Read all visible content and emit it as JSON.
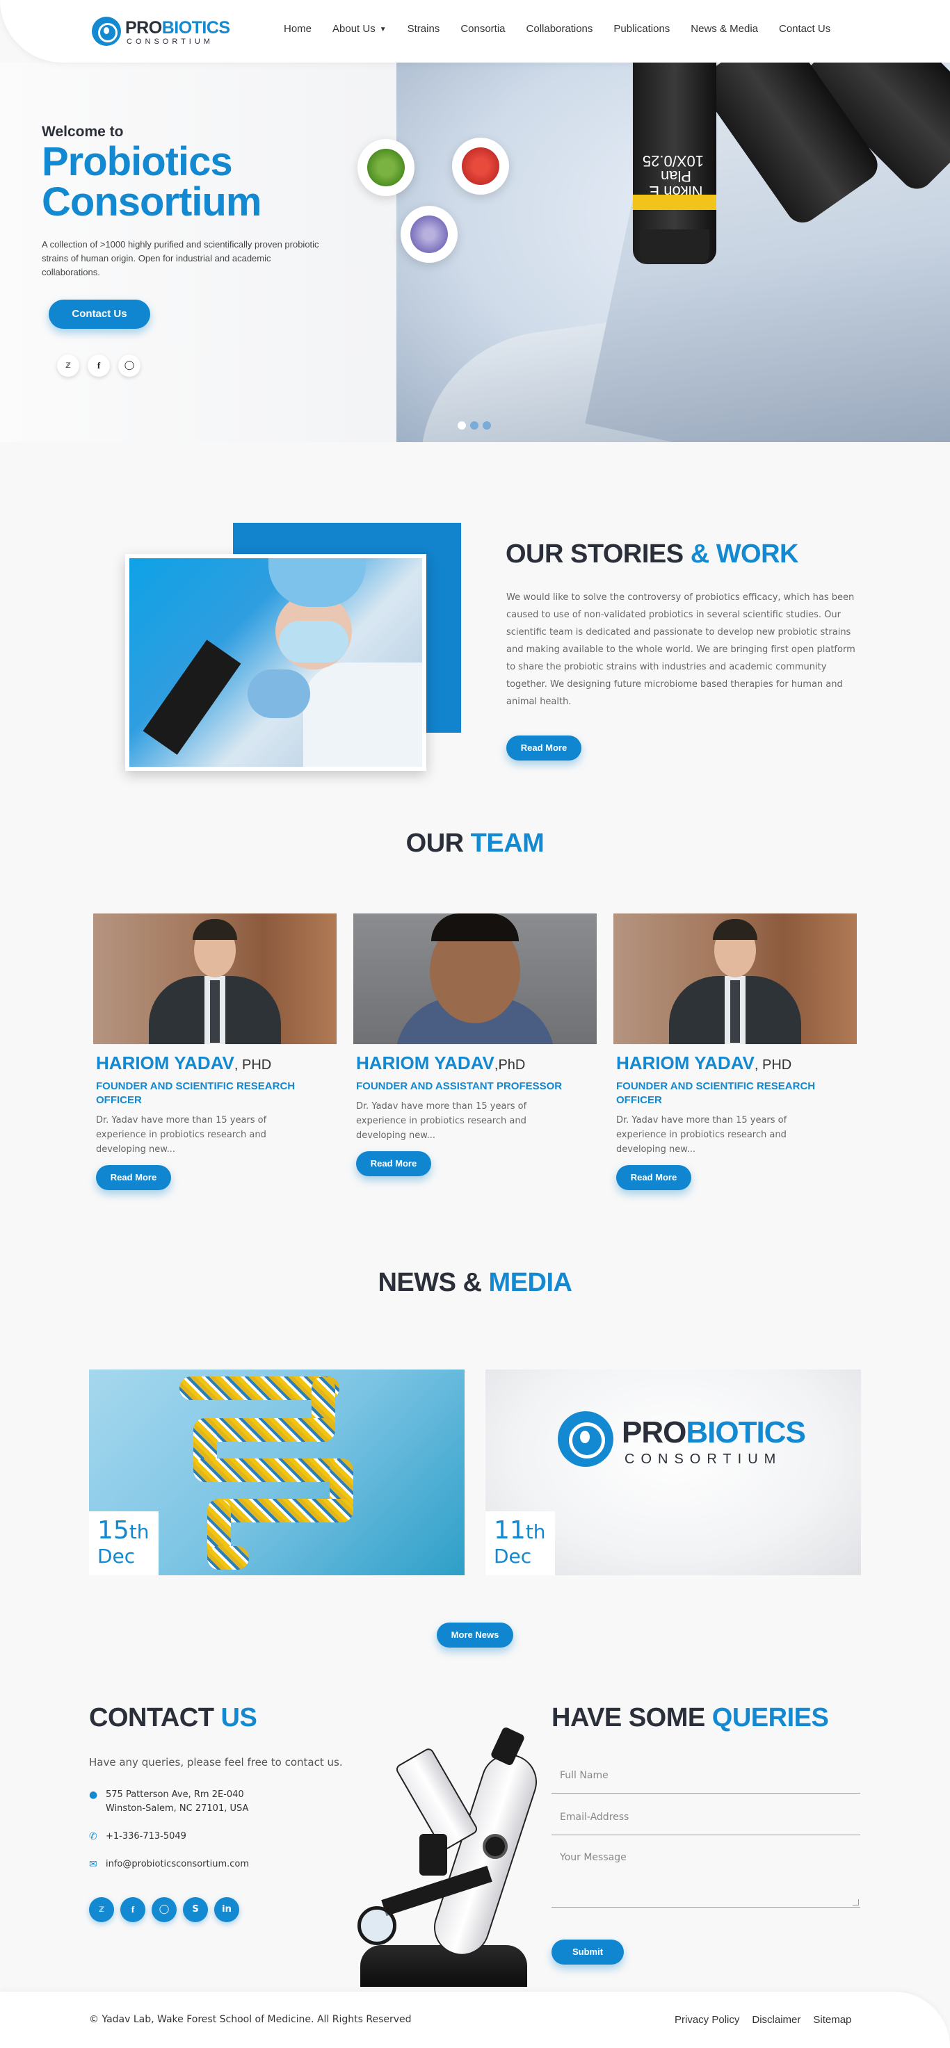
{
  "brand": {
    "part1": "PRO",
    "part2": "BIOTICS",
    "sub": "CONSORTIUM"
  },
  "nav": {
    "items": [
      {
        "label": "Home"
      },
      {
        "label": "About Us",
        "dropdown": true
      },
      {
        "label": "Strains"
      },
      {
        "label": "Consortia"
      },
      {
        "label": "Collaborations"
      },
      {
        "label": "Publications"
      },
      {
        "label": "News & Media"
      },
      {
        "label": "Contact Us"
      }
    ]
  },
  "hero": {
    "welcome": "Welcome to",
    "title": "Probiotics Consortium",
    "description": "A collection of >1000 highly purified and scientifically proven probiotic strains of human origin. Open for industrial and academic collaborations.",
    "cta": "Contact Us",
    "socials": [
      "twitter-icon",
      "facebook-icon",
      "instagram-icon"
    ],
    "objective_label": "Nikon E Plan 10X/0.25",
    "slider": {
      "total": 3,
      "active": 1
    }
  },
  "stories": {
    "title_dark": "OUR STORIES",
    "title_blue": "& WORK",
    "text": "We would like to solve the controversy of probiotics efficacy, which has been caused to use of non-validated probiotics in several scientific studies. Our scientific team is dedicated and passionate to develop new probiotic strains and making available to the whole world. We are bringing first open platform to share the probiotic strains with industries and academic community together. We designing future microbiome based therapies for human and animal health.",
    "button": "Read More"
  },
  "team": {
    "title_dark": "OUR",
    "title_blue": "TEAM",
    "members": [
      {
        "name": "HARIOM YADAV",
        "degree": ", PHD",
        "role": "FOUNDER AND SCIENTIFIC RESEARCH OFFICER",
        "bio": "Dr. Yadav have more than 15 years of experience in probiotics research and developing new...",
        "button": "Read More"
      },
      {
        "name": "HARIOM YADAV",
        "degree": ",PhD",
        "role": "FOUNDER AND ASSISTANT PROFESSOR",
        "bio": "Dr. Yadav have more than 15 years of experience in probiotics research and developing new...",
        "button": "Read More"
      },
      {
        "name": "HARIOM YADAV",
        "degree": ", PHD",
        "role": "FOUNDER AND SCIENTIFIC RESEARCH OFFICER",
        "bio": "Dr. Yadav have more than 15 years of experience in probiotics research and developing new...",
        "button": "Read More"
      }
    ]
  },
  "news": {
    "title_dark": "NEWS &",
    "title_blue": "MEDIA",
    "items": [
      {
        "day": "15",
        "suffix": "th",
        "month": "Dec"
      },
      {
        "day": "11",
        "suffix": "th",
        "month": "Dec"
      }
    ],
    "button": "More News"
  },
  "contact": {
    "title_dark": "CONTACT",
    "title_blue": "US",
    "intro": "Have any queries, please feel free to contact us.",
    "address_line1": "575 Patterson Ave, Rm 2E-040",
    "address_line2": "Winston-Salem, NC 27101, USA",
    "phone": "+1-336-713-5049",
    "email": "info@probioticsconsortium.com",
    "socials": [
      "twitter-icon",
      "facebook-icon",
      "instagram-icon",
      "skype-icon",
      "linkedin-icon"
    ]
  },
  "queries": {
    "title_dark": "HAVE SOME",
    "title_blue": "QUERIES",
    "name_placeholder": "Full Name",
    "email_placeholder": "Email-Address",
    "message_placeholder": "Your Message",
    "submit": "Submit"
  },
  "footer": {
    "copyright": "© Yadav Lab, Wake Forest School of Medicine. All Rights Reserved",
    "links": [
      "Privacy Policy",
      "Disclaimer",
      "Sitemap"
    ]
  },
  "colors": {
    "accent": "#1389d1",
    "dark": "#2a2f3a",
    "background": "#f8f8f8"
  }
}
